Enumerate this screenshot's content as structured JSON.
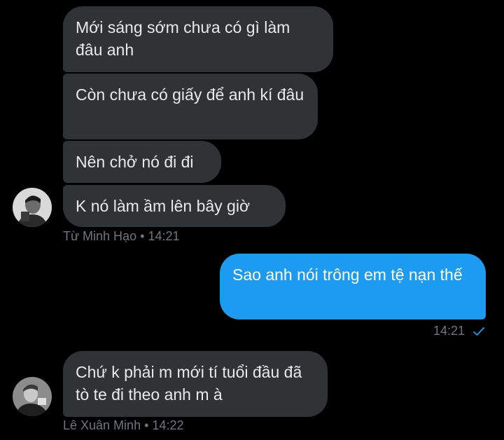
{
  "colors": {
    "background": "#000000",
    "incoming_bubble": "#2f3336",
    "outgoing_bubble": "#1d9bf0",
    "incoming_text": "#e7e9ea",
    "meta_text": "#71767b"
  },
  "messages": [
    {
      "sender": "Từ Minh Hạo",
      "text": "Mới sáng sớm chưa có gì làm đâu anh"
    },
    {
      "sender": "Từ Minh Hạo",
      "text": "Còn chưa có giấy để anh kí đâu"
    },
    {
      "sender": "Từ Minh Hạo",
      "text": "Nên chở nó đi đi"
    },
    {
      "sender": "Từ Minh Hạo",
      "text": "K nó làm ầm lên bây giờ"
    },
    {
      "sender": "me",
      "text": "Sao anh nói trông em tệ nạn thế"
    },
    {
      "sender": "Lê Xuân Minh",
      "text": "Chứ k phải m mới tí tuổi đầu đã tò te đi theo anh m à"
    }
  ],
  "group1_meta": {
    "name": "Từ Minh Hạo",
    "sep": "•",
    "time": "14:21"
  },
  "outgoing_meta": {
    "time": "14:21",
    "status_icon": "sent-check-icon"
  },
  "group2_meta": {
    "name": "Lê Xuân Minh",
    "sep": "•",
    "time": "14:22"
  }
}
